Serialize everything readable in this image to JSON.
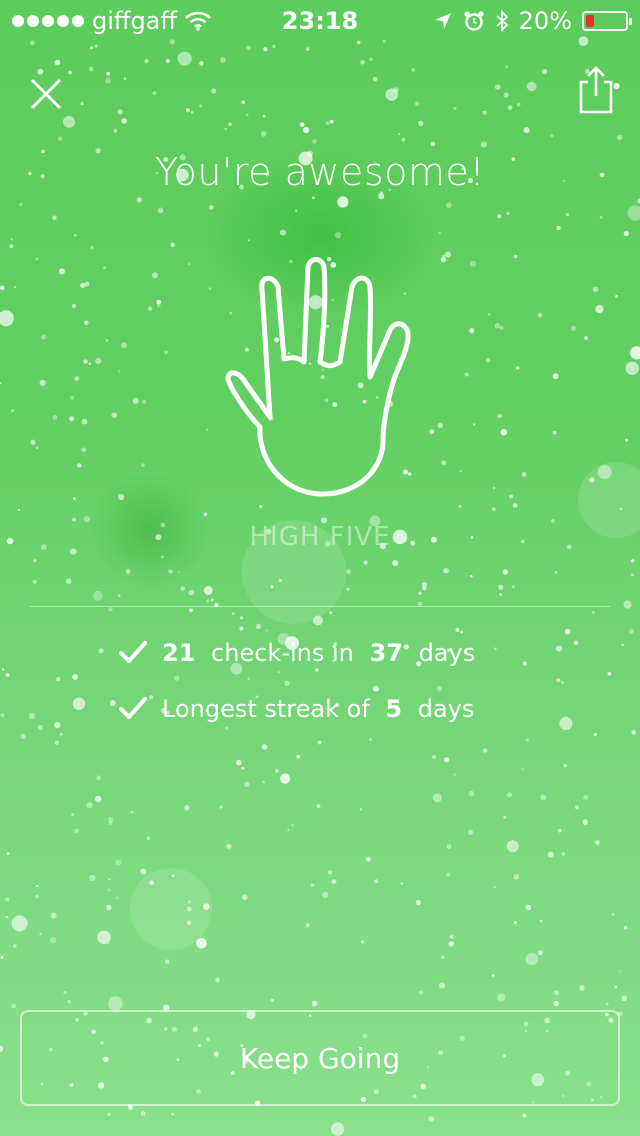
{
  "status_bar": {
    "carrier": "giffgaff",
    "time": "23:18",
    "battery": "20%",
    "battery_color": "#e3322b",
    "icons": [
      "signal-dots-icon",
      "wifi-icon",
      "location-arrow-icon",
      "alarm-icon",
      "bluetooth-icon",
      "battery-icon"
    ]
  },
  "header": {
    "close_icon": "close-icon",
    "share_icon": "share-icon"
  },
  "title": "You're awesome!",
  "badge": {
    "icon": "hand-icon",
    "label": "HIGH FIVE"
  },
  "stats": [
    {
      "icon": "checkmark-icon",
      "count": "21",
      "mid": "check-ins in",
      "days": "37",
      "suffix": "days"
    },
    {
      "icon": "checkmark-icon",
      "prefix": "Longest streak of",
      "value": "5",
      "suffix": "days"
    }
  ],
  "cta": {
    "label": "Keep Going"
  },
  "colors": {
    "background_top": "#5ccc5b",
    "background_bottom": "#8ae08c",
    "text": "#ffffff"
  }
}
